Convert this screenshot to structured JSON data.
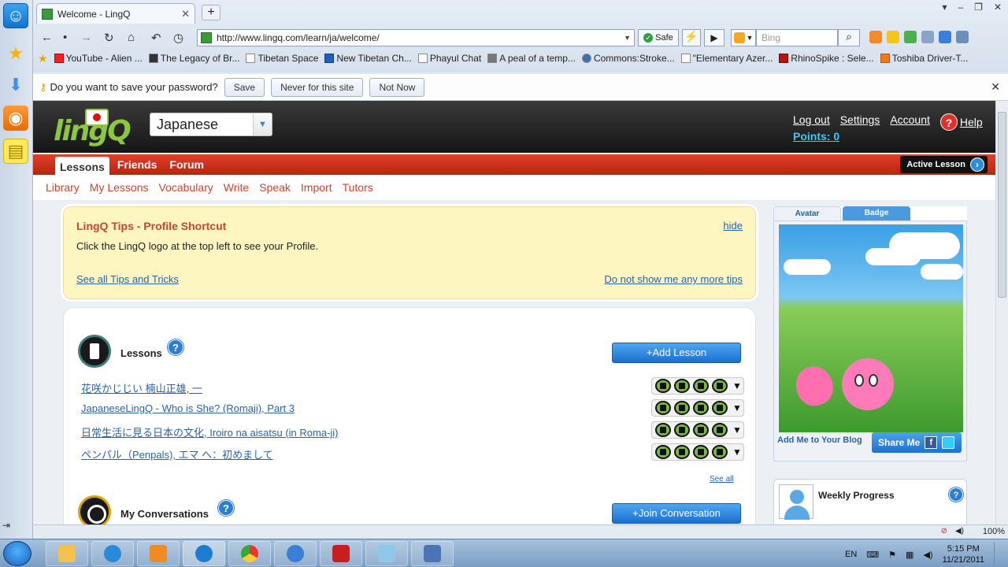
{
  "browser": {
    "tab_title": "Welcome - LingQ",
    "url": "http://www.lingq.com/learn/ja/welcome/",
    "safe_label": "Safe",
    "search_placeholder": "Bing",
    "bookmarks": [
      "YouTube - Alien ...",
      "The Legacy of Br...",
      "Tibetan Space",
      "New Tibetan Ch...",
      "Phayul Chat",
      "A peal of a temp...",
      "Commons:Stroke...",
      "\"Elementary Azer...",
      "RhinoSpike : Sele...",
      "Toshiba Driver-T..."
    ],
    "password_prompt": "Do you want to save your password?",
    "password_buttons": {
      "save": "Save",
      "never": "Never for this site",
      "not_now": "Not Now"
    },
    "zoom": "100%"
  },
  "site": {
    "logo_text": "lingQ",
    "language": "Japanese",
    "top_links": {
      "logout": "Log out",
      "settings": "Settings",
      "account": "Account",
      "help": "Help"
    },
    "points": "Points: 0",
    "main_tabs": [
      "Lessons",
      "Friends",
      "Forum"
    ],
    "active_lesson": "Active Lesson",
    "sub_nav": [
      "Library",
      "My Lessons",
      "Vocabulary",
      "Write",
      "Speak",
      "Import",
      "Tutors"
    ]
  },
  "tips": {
    "title": "LingQ Tips - Profile Shortcut",
    "body": "Click the LingQ logo at the top left to see your Profile.",
    "hide": "hide",
    "see_all": "See all Tips and Tricks",
    "do_not_show": "Do not show me any more tips"
  },
  "lessons": {
    "title": "Lessons",
    "add_button": "+Add Lesson",
    "items": [
      "花咲かじじい 楠山正雄, 一",
      "JapaneseLingQ - Who is She? (Romaji), Part 3",
      "日常生活に見る日本の文化, Iroiro na aisatsu (in Roma-ji)",
      "ペンパル（Penpals), エマ へ：初めまして"
    ],
    "see_all": "See all"
  },
  "conversations": {
    "title": "My Conversations",
    "join_button": "+Join Conversation"
  },
  "avatar": {
    "tab_avatar": "Avatar",
    "tab_badge": "Badge",
    "add_blog": "Add Me to Your Blog",
    "share": "Share Me"
  },
  "weekly": {
    "title": "Weekly Progress"
  },
  "taskbar": {
    "language": "EN",
    "time": "5:15 PM",
    "date": "11/21/2011"
  }
}
